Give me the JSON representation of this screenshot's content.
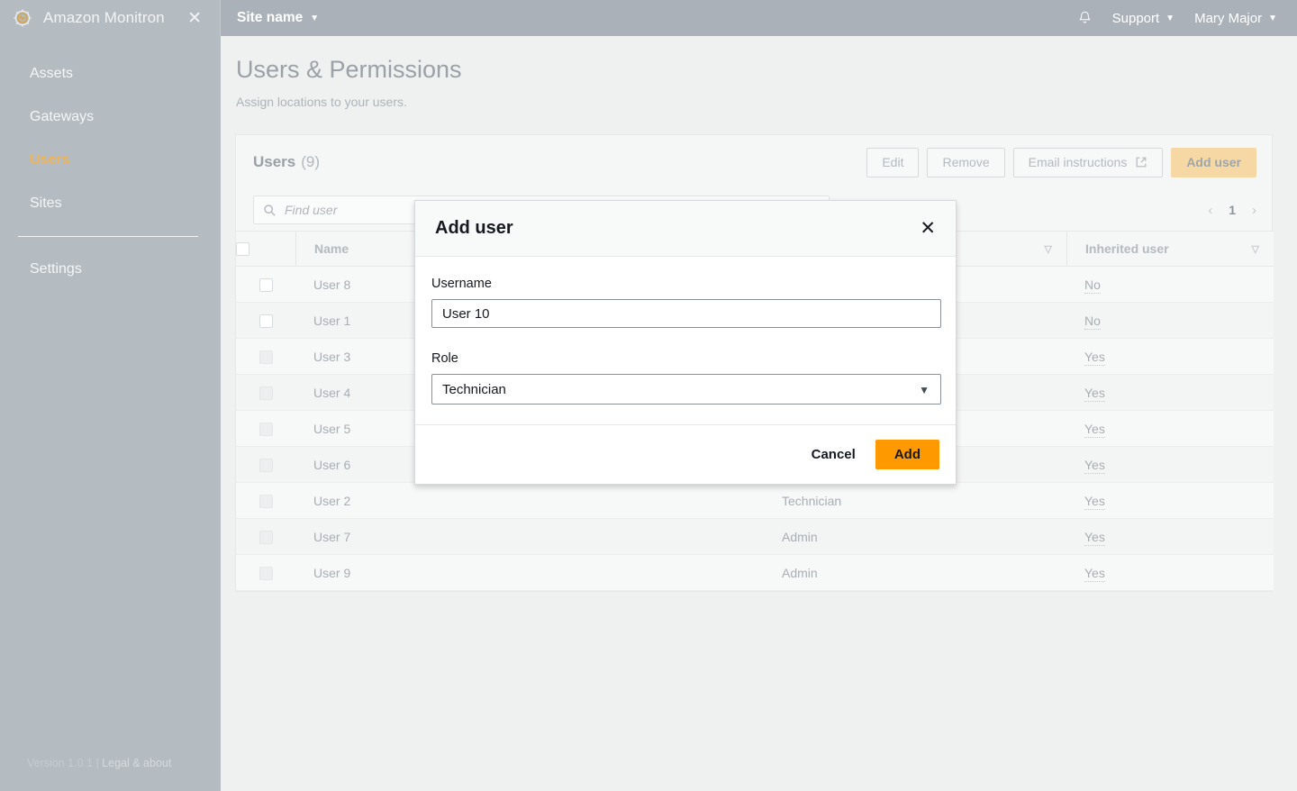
{
  "topbar": {
    "brand_title": "Amazon Monitron",
    "brand_logo_icon": "gear-chart-logo-icon",
    "brand_close_icon": "close-icon",
    "site_selector": "Site name",
    "site_caret_icon": "chevron-down-icon",
    "notifications_icon": "bell-icon",
    "support_label": "Support",
    "support_caret_icon": "chevron-down-icon",
    "user_label": "Mary Major",
    "user_caret_icon": "chevron-down-icon"
  },
  "sidebar": {
    "items": [
      {
        "label": "Assets",
        "active": false
      },
      {
        "label": "Gateways",
        "active": false
      },
      {
        "label": "Users",
        "active": true
      },
      {
        "label": "Sites",
        "active": false
      },
      {
        "label": "Settings",
        "active": false
      }
    ],
    "version": "Version 1.0.1",
    "separator": "|",
    "legal_link": "Legal & about"
  },
  "page": {
    "title": "Users & Permissions",
    "subtitle": "Assign locations to your users."
  },
  "card": {
    "title": "Users",
    "count": "(9)",
    "buttons": {
      "edit": "Edit",
      "remove": "Remove",
      "email_instructions": "Email instructions",
      "email_instructions_icon": "external-link-icon",
      "add_user": "Add user"
    },
    "search": {
      "placeholder": "Find user",
      "value": "",
      "icon": "search-icon"
    },
    "pagination": {
      "prev_icon": "chevron-left-icon",
      "page": "1",
      "next_icon": "chevron-right-icon"
    }
  },
  "table": {
    "columns": {
      "name": "Name",
      "role": "",
      "inherited": "Inherited user"
    },
    "sort_icon": "sort-descending-icon",
    "rows": [
      {
        "checked": false,
        "dim": false,
        "name": "User 8",
        "role": "",
        "inherited": "No"
      },
      {
        "checked": false,
        "dim": false,
        "name": "User 1",
        "role": "",
        "inherited": "No"
      },
      {
        "checked": false,
        "dim": true,
        "name": "User 3",
        "role": "",
        "inherited": "Yes"
      },
      {
        "checked": false,
        "dim": true,
        "name": "User 4",
        "role": "",
        "inherited": "Yes"
      },
      {
        "checked": false,
        "dim": true,
        "name": "User 5",
        "role": "",
        "inherited": "Yes"
      },
      {
        "checked": false,
        "dim": true,
        "name": "User 6",
        "role": "",
        "inherited": "Yes"
      },
      {
        "checked": false,
        "dim": true,
        "name": "User 2",
        "role": "Technician",
        "inherited": "Yes"
      },
      {
        "checked": false,
        "dim": true,
        "name": "User 7",
        "role": "Admin",
        "inherited": "Yes"
      },
      {
        "checked": false,
        "dim": true,
        "name": "User 9",
        "role": "Admin",
        "inherited": "Yes"
      }
    ]
  },
  "modal": {
    "title": "Add user",
    "close_icon": "close-icon",
    "username_label": "Username",
    "username_value": "User 10",
    "username_placeholder": "",
    "role_label": "Role",
    "role_value": "Technician",
    "role_caret_icon": "chevron-down-icon",
    "cancel_label": "Cancel",
    "add_label": "Add"
  },
  "colors": {
    "accent_orange": "#ff9900",
    "accent_orange_muted": "#f6d8a4",
    "sidebar_bg": "#b4bbc1",
    "topbar_bg": "#aab1b8",
    "active_nav": "#f0b458",
    "page_bg": "#eff1f1"
  }
}
